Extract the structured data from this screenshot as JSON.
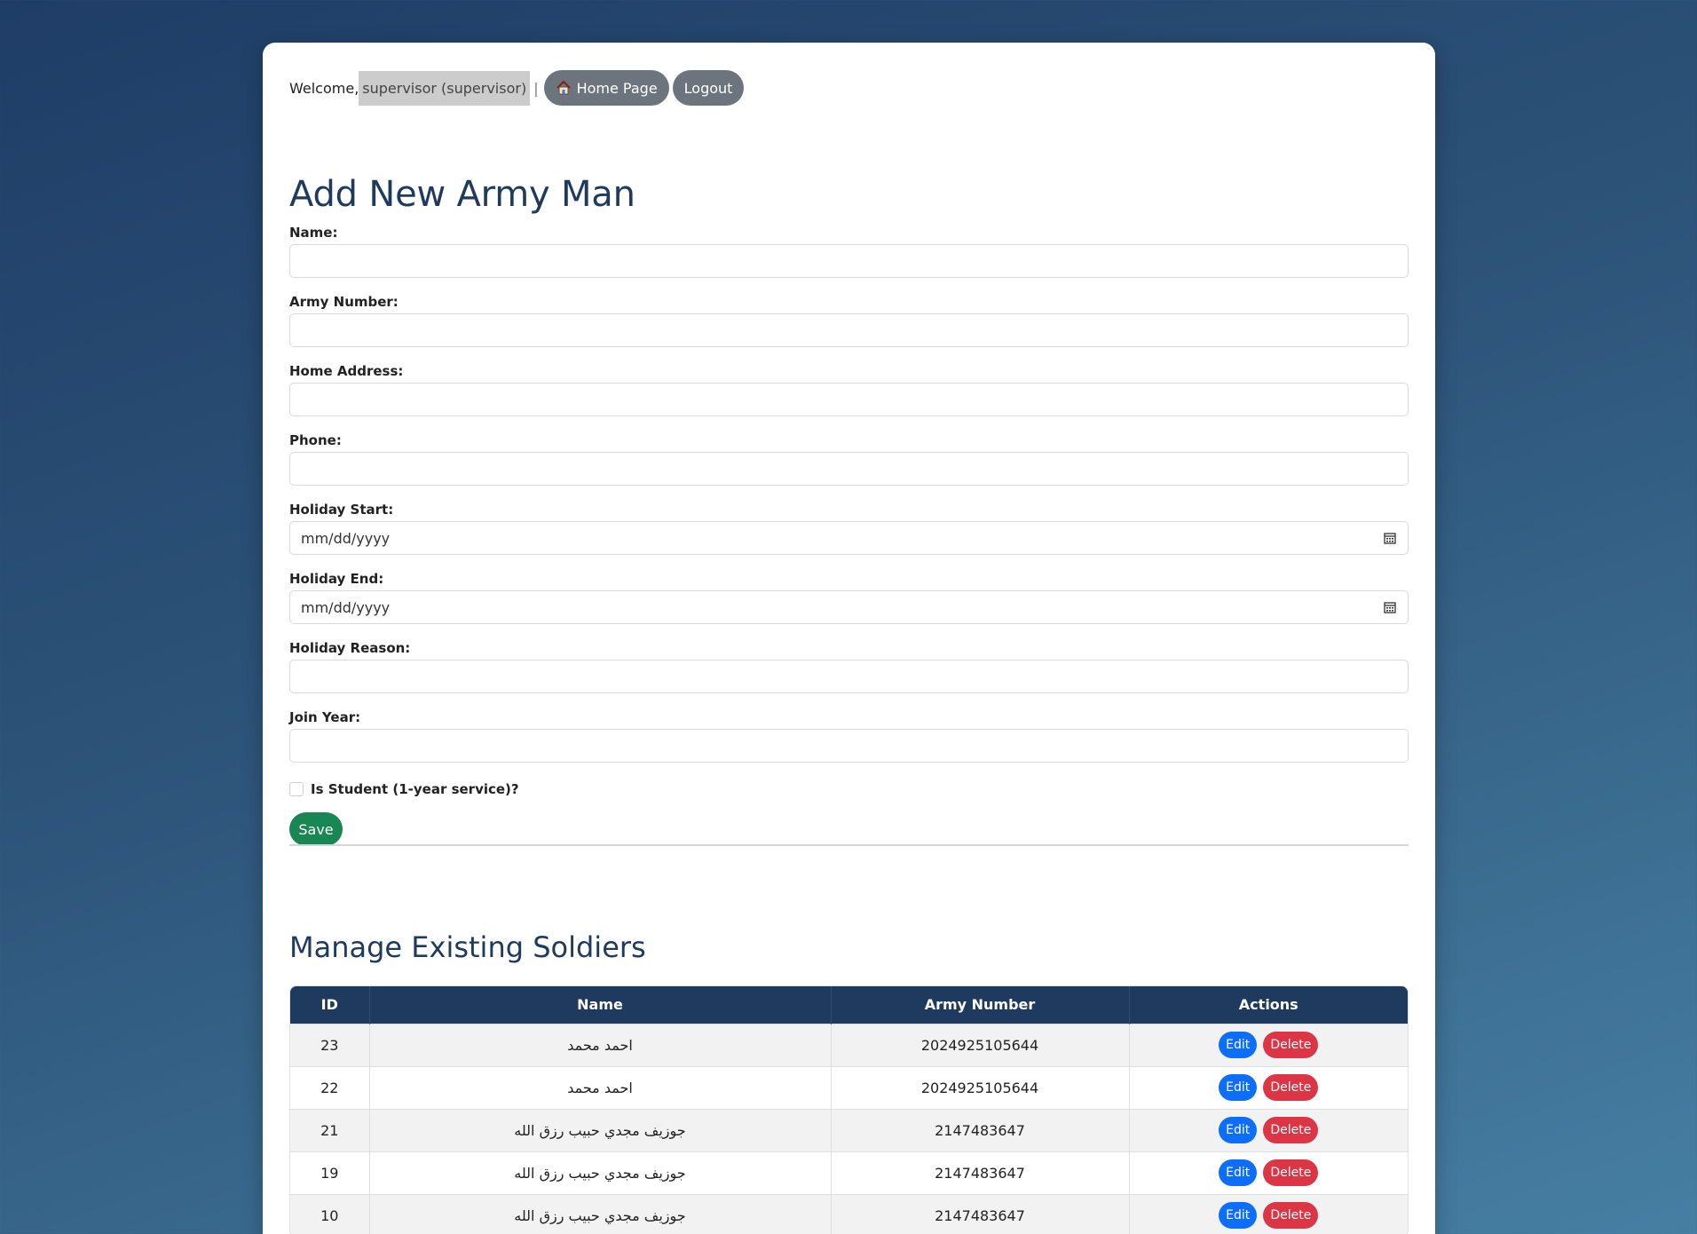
{
  "header": {
    "welcome_prefix": "Welcome,",
    "username": "supervisor (supervisor)",
    "separator": "|",
    "home_label": "Home Page",
    "logout_label": "Logout"
  },
  "form": {
    "title": "Add New Army Man",
    "fields": [
      {
        "label": "Name:",
        "value": ""
      },
      {
        "label": "Army Number:",
        "value": ""
      },
      {
        "label": "Home Address:",
        "value": ""
      },
      {
        "label": "Phone:",
        "value": ""
      },
      {
        "label": "Holiday Start:",
        "value": "mm/dd/yyyy"
      },
      {
        "label": "Holiday End:",
        "value": "mm/dd/yyyy"
      },
      {
        "label": "Holiday Reason:",
        "value": ""
      },
      {
        "label": "Join Year:",
        "value": ""
      }
    ],
    "checkbox_label": "Is Student (1-year service)?",
    "save_label": "Save"
  },
  "table": {
    "title": "Manage Existing Soldiers",
    "headers": [
      "ID",
      "Name",
      "Army Number",
      "Actions"
    ],
    "rows": [
      {
        "id": "23",
        "name": "احمد محمد",
        "army_number": "2024925105644"
      },
      {
        "id": "22",
        "name": "احمد محمد",
        "army_number": "2024925105644"
      },
      {
        "id": "21",
        "name": "جوزيف مجدي حبيب رزق الله",
        "army_number": "2147483647"
      },
      {
        "id": "19",
        "name": "جوزيف مجدي حبيب رزق الله",
        "army_number": "2147483647"
      },
      {
        "id": "10",
        "name": "جوزيف مجدي حبيب رزق الله",
        "army_number": "2147483647"
      }
    ],
    "edit_label": "Edit",
    "delete_label": "Delete"
  },
  "colors": {
    "primary_dark": "#1e3a5f",
    "save": "#198754",
    "edit": "#0d6efd",
    "delete": "#dc3545",
    "nav_button": "#6c757d"
  },
  "icons": {
    "home": "house-icon",
    "date": "calendar-icon"
  }
}
